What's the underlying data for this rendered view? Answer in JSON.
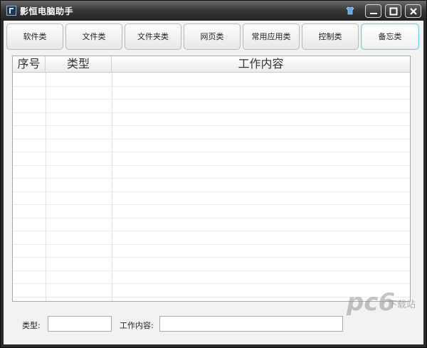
{
  "window": {
    "title": "影恒电脑助手"
  },
  "tabs": [
    {
      "label": "软件类"
    },
    {
      "label": "文件类"
    },
    {
      "label": "文件夹类"
    },
    {
      "label": "网页类"
    },
    {
      "label": "常用应用类"
    },
    {
      "label": "控制类"
    },
    {
      "label": "备忘类",
      "active": true
    }
  ],
  "grid": {
    "columns": [
      {
        "header": "序号"
      },
      {
        "header": "类型"
      },
      {
        "header": "工作内容"
      }
    ],
    "rows": []
  },
  "form": {
    "type_label": "类型:",
    "type_value": "",
    "content_label": "工作内容:",
    "content_value": ""
  },
  "watermark": {
    "brand": "pc6",
    "site": "下载站"
  },
  "colors": {
    "titlebar": "#2a2a2a",
    "active_tab_border": "#6ccfe0",
    "background": "#f2f2f2"
  },
  "icons": {
    "app": "app-logo-icon",
    "skin": "shirt-icon",
    "minimize": "minimize-icon",
    "maximize": "maximize-icon",
    "close": "close-icon"
  }
}
